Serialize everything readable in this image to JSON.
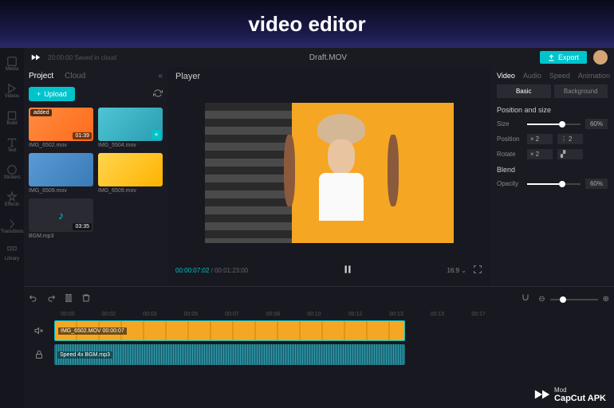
{
  "banner_title": "video editor",
  "topbar": {
    "saved": "20:00:00 Saved in cloud",
    "title": "Draft.MOV",
    "export": "Export"
  },
  "rail": [
    {
      "label": "Media"
    },
    {
      "label": "Videos"
    },
    {
      "label": "Build"
    },
    {
      "label": "Text"
    },
    {
      "label": "Stickers"
    },
    {
      "label": "Effects"
    },
    {
      "label": "Transitions"
    },
    {
      "label": "Library"
    }
  ],
  "library": {
    "tab_project": "Project",
    "tab_cloud": "Cloud",
    "upload": "Upload",
    "items": [
      {
        "name": "IMG_6502.mov",
        "duration": "01:39",
        "badge": "added"
      },
      {
        "name": "IMG_5504.mov"
      },
      {
        "name": "IMG_6509.mov"
      },
      {
        "name": "IMG_6509.mov"
      },
      {
        "name": "BGM.mp3",
        "duration": "03:35"
      }
    ]
  },
  "player": {
    "title": "Player",
    "current": "00:00:07:02",
    "total": "00:01:23:00",
    "ratio": "16:9"
  },
  "panel": {
    "tabs": [
      "Video",
      "Audio",
      "Speed",
      "Animation"
    ],
    "sub_tabs": [
      "Basic",
      "Background"
    ],
    "section_position": "Position and size",
    "size_label": "Size",
    "size_value": "60%",
    "position_label": "Position",
    "pos_x": "2",
    "pos_y": "2",
    "rotate_label": "Rotate",
    "rotate_value": "2",
    "section_blend": "Blend",
    "opacity_label": "Opacity",
    "opacity_value": "60%"
  },
  "timeline": {
    "ruler": [
      "00:00",
      "00:02",
      "00:03",
      "00:05",
      "00:07",
      "00:08",
      "00:10",
      "00:12",
      "00:13",
      "00:15",
      "00:17"
    ],
    "video_clip": "IMG_6502.MOV   00:00:07",
    "audio_clip": "Speed 4x   BGM.mp3"
  },
  "watermark": {
    "brand": "CapCut APK",
    "sub": "Mod"
  },
  "chart_data": null
}
